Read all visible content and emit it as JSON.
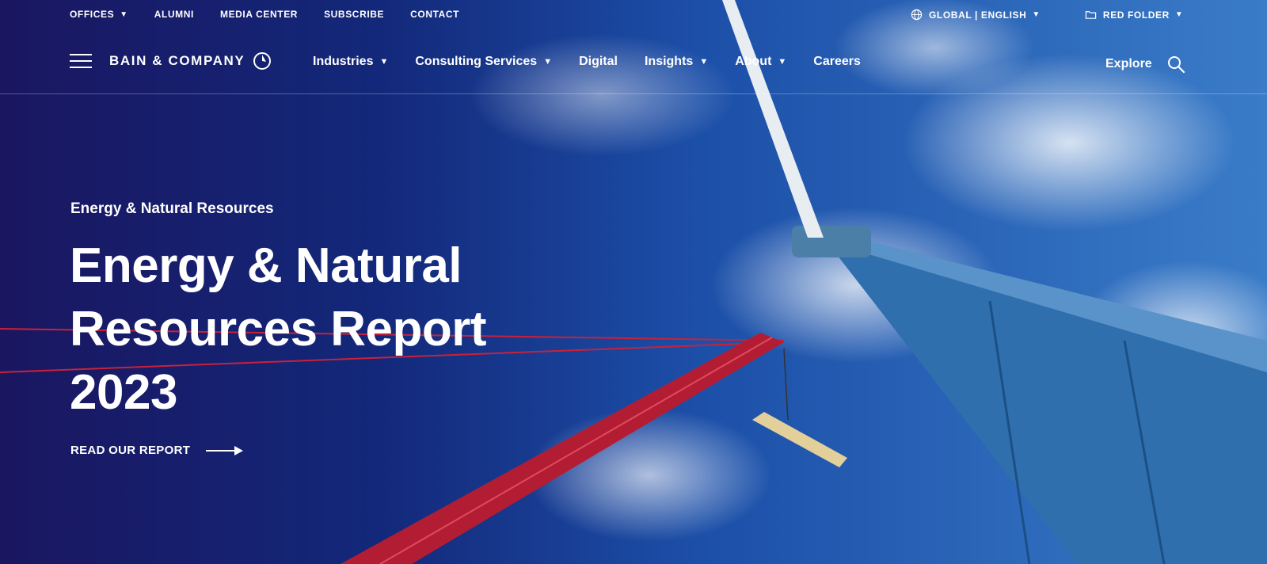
{
  "utility": {
    "offices": "OFFICES",
    "alumni": "ALUMNI",
    "media_center": "MEDIA CENTER",
    "subscribe": "SUBSCRIBE",
    "contact": "CONTACT",
    "global": "GLOBAL | ENGLISH",
    "red_folder": "RED FOLDER"
  },
  "brand": {
    "name": "BAIN & COMPANY"
  },
  "nav": {
    "industries": "Industries",
    "consulting": "Consulting Services",
    "digital": "Digital",
    "insights": "Insights",
    "about": "About",
    "careers": "Careers",
    "explore": "Explore"
  },
  "hero": {
    "eyebrow": "Energy & Natural Resources",
    "title": "Energy & Natural Resources Report 2023",
    "cta": "READ OUR REPORT"
  },
  "icons": {
    "menu": "hamburger-menu-icon",
    "logo_mark": "bain-logo-mark-icon",
    "globe": "globe-icon",
    "folder": "folder-icon",
    "search": "search-icon",
    "arrow": "arrow-right-icon",
    "caret": "caret-down-icon"
  },
  "colors": {
    "text": "#ffffff",
    "sky_dark": "#1a1660",
    "sky": "#1c4fa8",
    "crane_red": "#c8223a",
    "turbine_blue": "#2f6fae"
  }
}
